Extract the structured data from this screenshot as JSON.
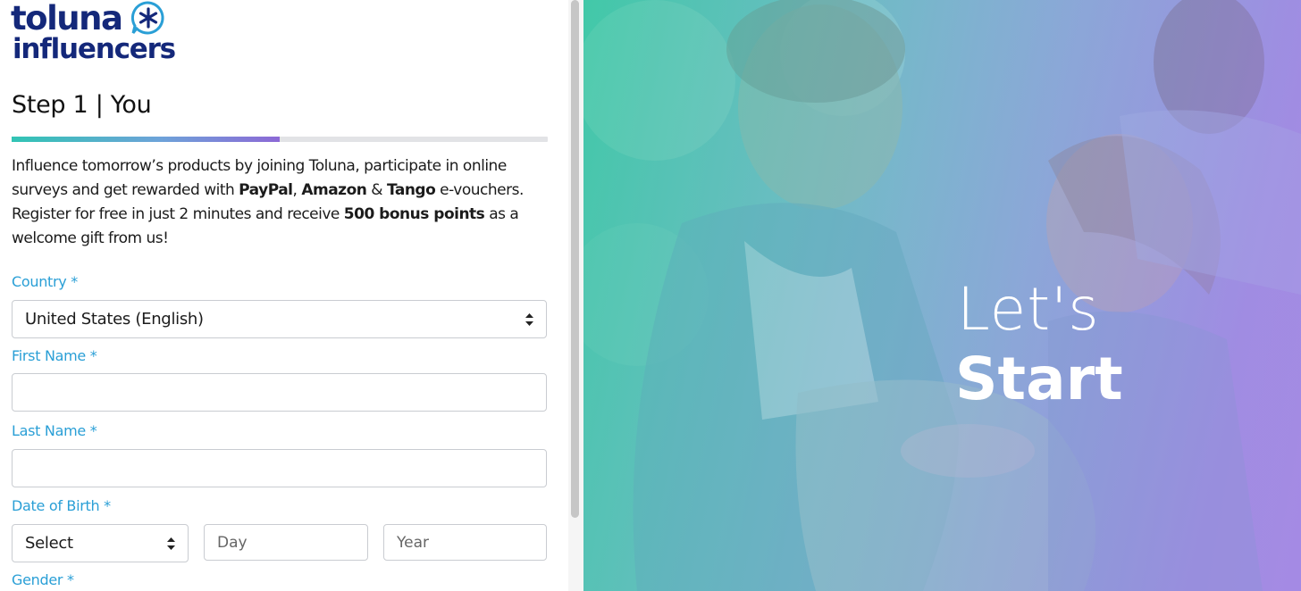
{
  "brand": {
    "logo_word1": "toluna",
    "logo_word2": "influencers"
  },
  "colors": {
    "brand_navy": "#14287a",
    "label_blue": "#2a9fd6",
    "progress_start": "#31c4b4",
    "progress_end": "#8c69d6"
  },
  "step": {
    "title": "Step 1 | You",
    "progress_fraction": 0.5
  },
  "intro": {
    "p1_a": "Influence tomorrow’s products by joining Toluna, participate in online surveys and get rewarded with ",
    "paypal": "PayPal",
    "comma": ", ",
    "amazon": "Amazon",
    "amp": " & ",
    "tango": "Tango",
    "p1_b": " e-vouchers.",
    "p2_a": "Register for free in just 2 minutes and receive ",
    "bonus": "500 bonus points",
    "p2_b": " as a welcome gift from us!"
  },
  "form": {
    "country_label": "Country *",
    "country_value": "United States (English)",
    "first_name_label": "First Name *",
    "first_name_value": "",
    "last_name_label": "Last Name *",
    "last_name_value": "",
    "dob_label": "Date of Birth *",
    "dob_month_value": "Select",
    "dob_day_placeholder": "Day",
    "dob_year_placeholder": "Year",
    "gender_label": "Gender *"
  },
  "hero": {
    "line1": "Let's",
    "line2": "Start",
    "image_name": "smiling-young-people-photo"
  }
}
